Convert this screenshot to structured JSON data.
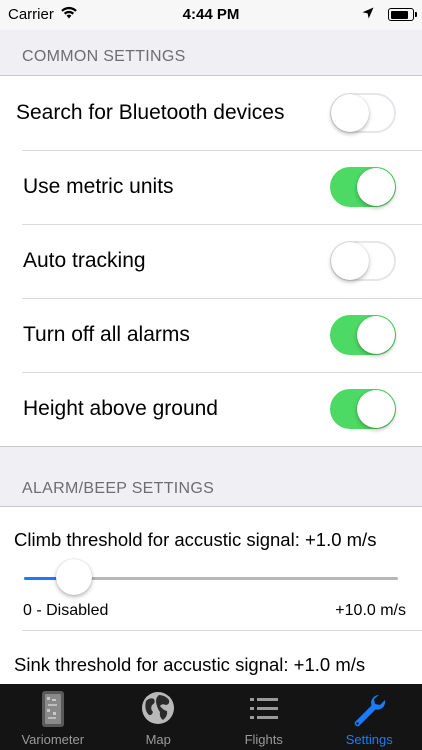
{
  "status_bar": {
    "carrier": "Carrier",
    "time": "4:44 PM",
    "battery_level": 0.9,
    "icons": [
      "wifi-icon",
      "location-arrow-icon",
      "battery-icon"
    ]
  },
  "common_settings": {
    "header": "COMMON SETTINGS",
    "rows": [
      {
        "label": "Search for Bluetooth devices",
        "on": false
      },
      {
        "label": "Use metric units",
        "on": true
      },
      {
        "label": "Auto tracking",
        "on": false
      },
      {
        "label": "Turn off all alarms",
        "on": true
      },
      {
        "label": "Height above ground",
        "on": true
      }
    ]
  },
  "alarm_settings": {
    "header": "ALARM/BEEP SETTINGS",
    "climb": {
      "title": "Climb threshold for accustic signal: +1.0 m/s",
      "min_label": "0 - Disabled",
      "max_label": "+10.0 m/s",
      "value_fraction": 0.1
    },
    "sink": {
      "title": "Sink threshold for accustic signal: +1.0 m/s"
    }
  },
  "tab_bar": {
    "active_color": "#1a7bff",
    "tabs": [
      {
        "label": "Variometer",
        "icon": "variometer-icon",
        "active": false
      },
      {
        "label": "Map",
        "icon": "globe-icon",
        "active": false
      },
      {
        "label": "Flights",
        "icon": "list-icon",
        "active": false
      },
      {
        "label": "Settings",
        "icon": "wrench-icon",
        "active": true
      }
    ]
  },
  "colors": {
    "switch_on": "#4cd964",
    "background": "#efeff4"
  }
}
